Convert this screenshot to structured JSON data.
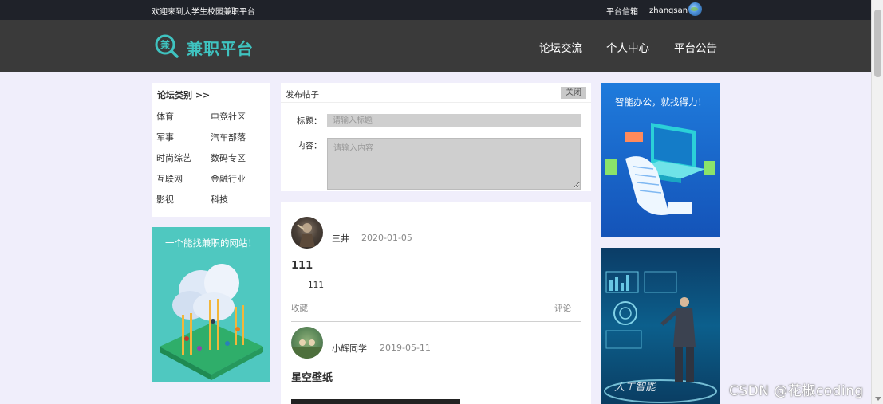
{
  "topbar": {
    "welcome": "欢迎来到大学生校园兼职平台",
    "platform_letter": "平台信箱",
    "username": "zhangsan",
    "separator": "|"
  },
  "header": {
    "logo_glyph": "兼",
    "logo_text": "兼职平台",
    "nav": [
      "论坛交流",
      "个人中心",
      "平台公告"
    ]
  },
  "categories": {
    "title": "论坛类别 >>",
    "items": [
      "体育",
      "电竞社区",
      "军事",
      "汽车部落",
      "时尚综艺",
      "数码专区",
      "互联网",
      "金融行业",
      "影视",
      "科技"
    ]
  },
  "ads": {
    "left_text": "一个能找兼职的网站！",
    "right_top_text": "智能办公，就找得力！",
    "right_bottom_text": "人工智能"
  },
  "post_form": {
    "title": "发布帖子",
    "close_label": "关闭",
    "title_label": "标题：",
    "title_placeholder": "请输入标题",
    "content_label": "内容：",
    "content_placeholder": "请输入内容"
  },
  "posts": [
    {
      "author": "三井",
      "date": "2020-01-05",
      "title": "111",
      "body": "111",
      "favorite": "收藏",
      "comment": "评论"
    },
    {
      "author": "小辉同学",
      "date": "2019-05-11",
      "title": "星空壁纸"
    }
  ],
  "watermark": "CSDN @花椒coding",
  "colors": {
    "accent": "#3fc3c0",
    "header_bg": "#3a3a3a",
    "topbar_bg": "#1f2229",
    "page_bg": "#f0eefb"
  }
}
